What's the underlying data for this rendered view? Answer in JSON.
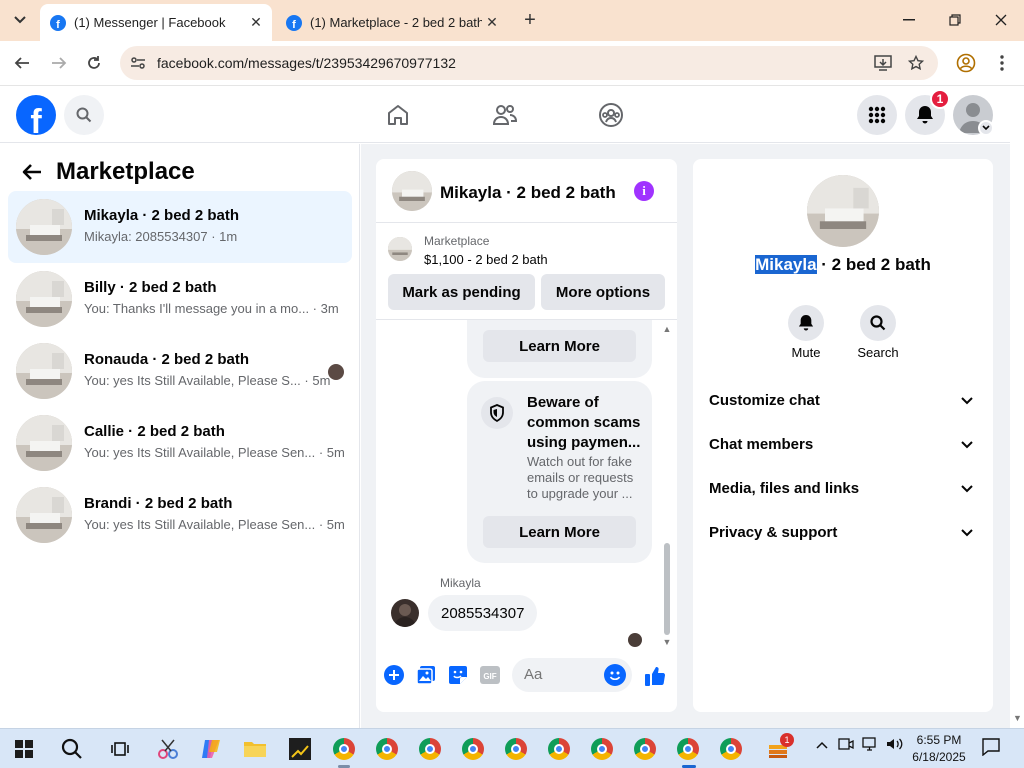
{
  "browser": {
    "tabs": [
      {
        "title": "(1) Messenger | Facebook",
        "active": true
      },
      {
        "title": "(1) Marketplace - 2 bed 2 bath",
        "active": false
      }
    ],
    "url": "facebook.com/messages/t/23953429670977132"
  },
  "fb_header": {
    "logo_letter": "f",
    "notification_count": "1"
  },
  "left": {
    "title": "Marketplace",
    "conversations": [
      {
        "name": "Mikayla · 2 bed 2 bath",
        "snippet": "Mikayla: 2085534307 · 1m",
        "selected": true,
        "seen": false
      },
      {
        "name": "Billy · 2 bed 2 bath",
        "snippet": "You: Thanks I'll message you in a mo... · 3m",
        "selected": false,
        "seen": false
      },
      {
        "name": "Ronauda · 2 bed 2 bath",
        "snippet": "You: yes Its Still Available, Please S... · 5m",
        "selected": false,
        "seen": true
      },
      {
        "name": "Callie · 2 bed 2 bath",
        "snippet": "You: yes Its Still Available, Please Sen... · 5m",
        "selected": false,
        "seen": false
      },
      {
        "name": "Brandi · 2 bed 2 bath",
        "snippet": "You: yes Its Still Available, Please Sen... · 5m",
        "selected": false,
        "seen": false
      }
    ]
  },
  "chat": {
    "title": "Mikayla · 2 bed 2 bath",
    "marketplace_label": "Marketplace",
    "listing": "$1,100 - 2 bed 2 bath",
    "mark_pending": "Mark as pending",
    "more_options": "More options",
    "learn_more": "Learn More",
    "scam_title_lines": [
      "Beware of",
      "common scams",
      "using paymen..."
    ],
    "scam_body_lines": [
      "Watch out for fake",
      "emails or requests",
      "to upgrade your ..."
    ],
    "sender": "Mikayla",
    "message": "2085534307",
    "composer_placeholder": "Aa",
    "gif_label": "GIF"
  },
  "details": {
    "title_highlight": "Mikayla",
    "title_rest": " · 2 bed 2 bath",
    "actions": [
      {
        "label": "Mute",
        "icon": "bell-icon"
      },
      {
        "label": "Search",
        "icon": "search-icon"
      }
    ],
    "sections": [
      "Customize chat",
      "Chat members",
      "Media, files and links",
      "Privacy & support"
    ]
  },
  "taskbar": {
    "time": "6:55 PM",
    "date": "6/18/2025",
    "tray_badge": "1"
  },
  "colors": {
    "fb_blue": "#0866ff",
    "selected_row": "#ebf5ff",
    "notification_red": "#e41e3f",
    "info_purple": "#a033ff",
    "tab_strip": "#f9e2cf"
  }
}
